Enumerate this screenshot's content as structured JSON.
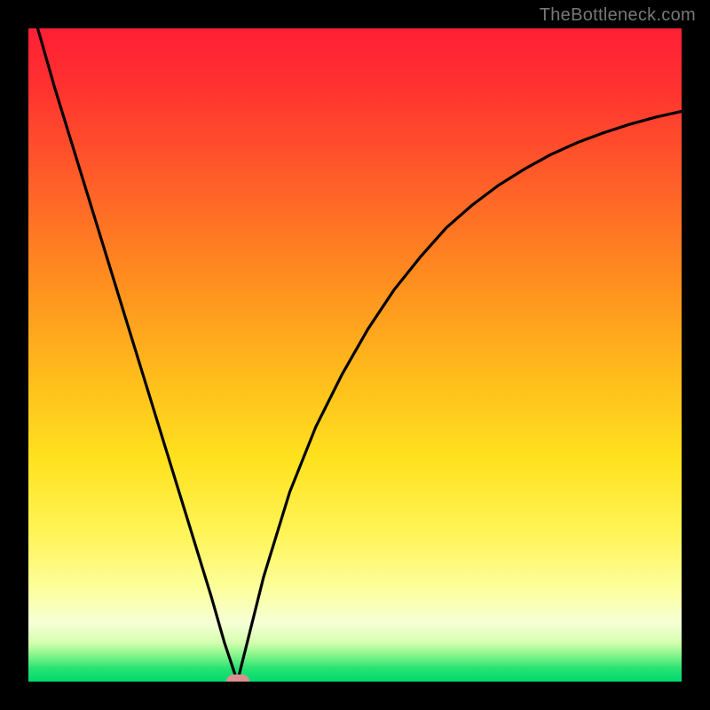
{
  "watermark": "TheBottleneck.com",
  "colors": {
    "gradient_top": "#ff1f36",
    "gradient_bottom": "#00d96e",
    "curve": "#000000",
    "marker": "#dd8f8f",
    "frame": "#000000"
  },
  "chart_data": {
    "type": "line",
    "title": "",
    "xlabel": "",
    "ylabel": "",
    "xlim": [
      0,
      100
    ],
    "ylim": [
      0,
      100
    ],
    "annotations": [
      {
        "kind": "marker",
        "x": 32,
        "y": 0,
        "shape": "rounded-rect",
        "color": "#dd8f8f"
      }
    ],
    "series": [
      {
        "name": "bottleneck-curve",
        "x": [
          0,
          4,
          8,
          12,
          16,
          20,
          24,
          28,
          30,
          32,
          34,
          36,
          40,
          44,
          48,
          52,
          56,
          60,
          64,
          68,
          72,
          76,
          80,
          84,
          88,
          92,
          96,
          100
        ],
        "y": [
          105,
          91,
          78,
          65,
          52,
          39,
          26,
          13,
          6,
          0,
          8,
          16,
          29,
          39,
          47,
          54,
          60,
          65,
          69.5,
          73,
          76,
          78.5,
          80.7,
          82.5,
          84,
          85.3,
          86.4,
          87.3
        ]
      }
    ]
  }
}
